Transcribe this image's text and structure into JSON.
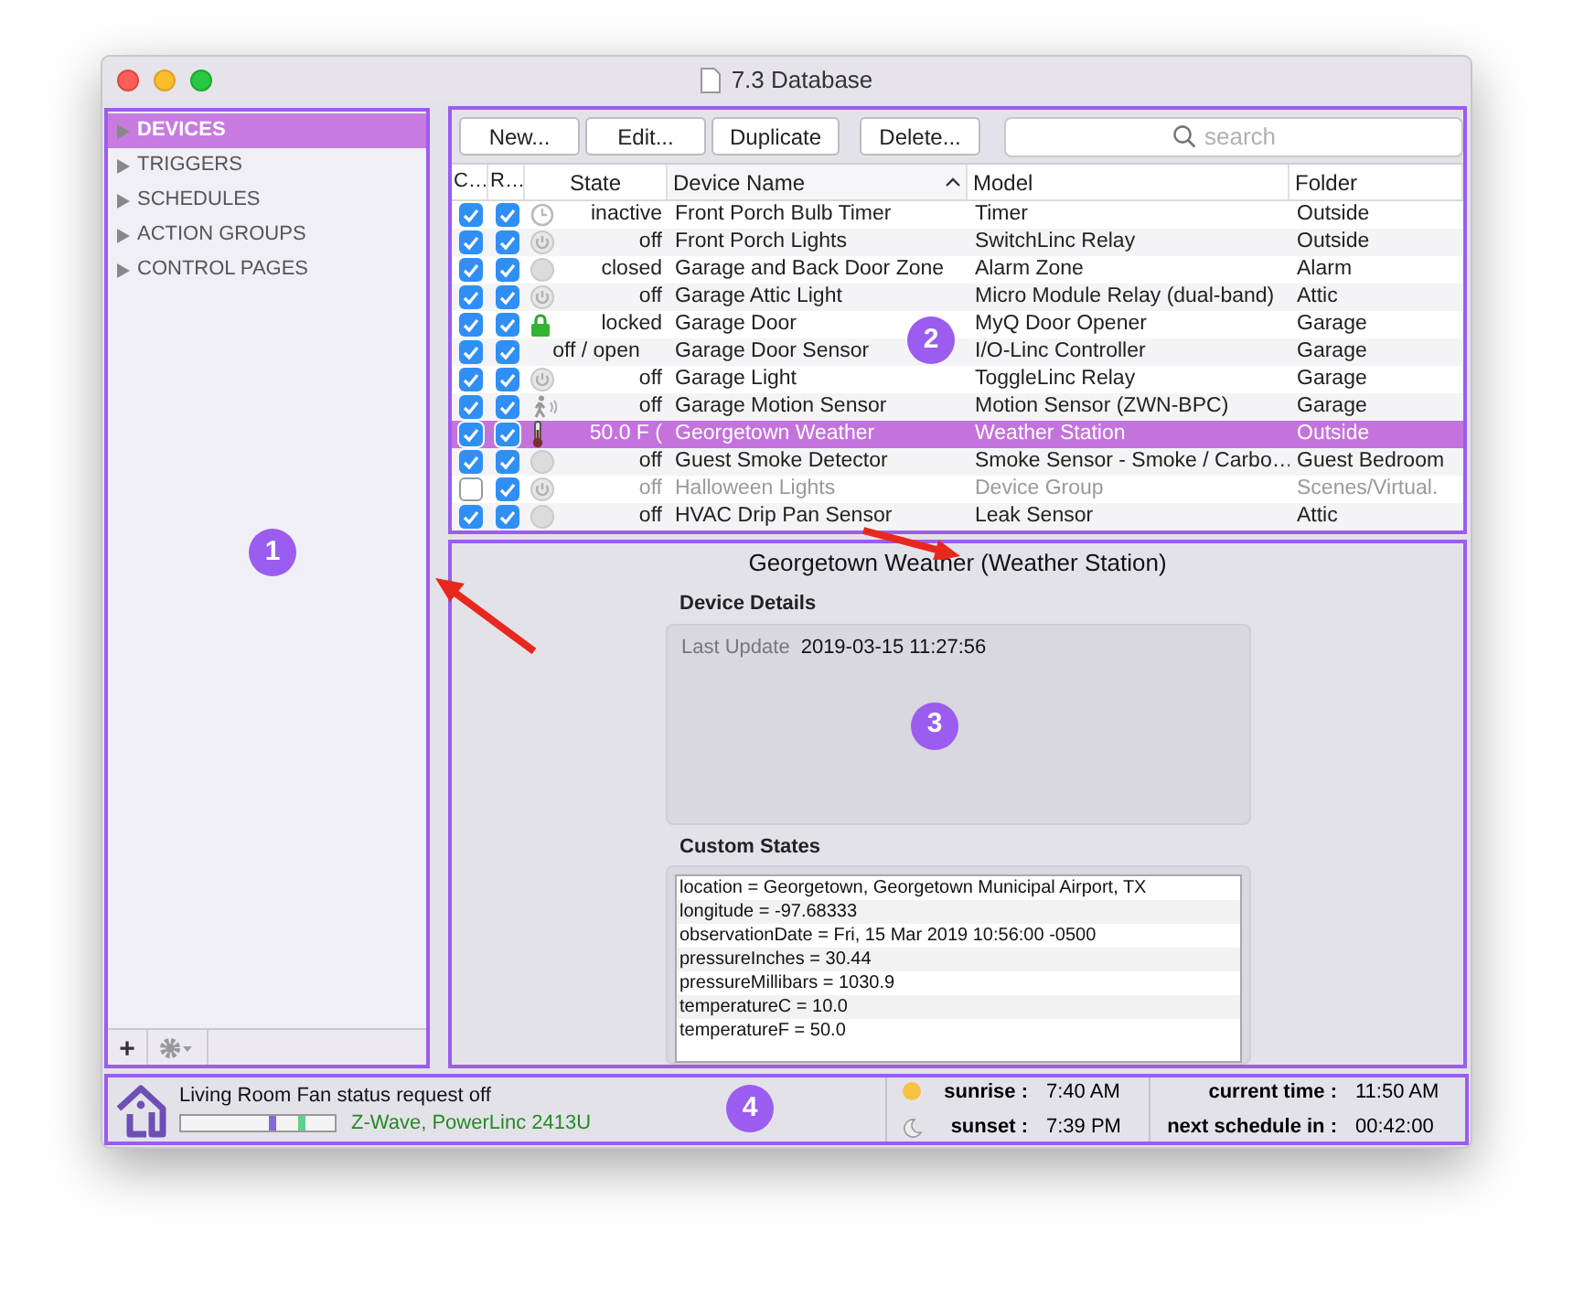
{
  "window": {
    "title": "7.3 Database"
  },
  "sidebar": {
    "items": [
      {
        "label": "DEVICES",
        "selected": true
      },
      {
        "label": "TRIGGERS",
        "selected": false
      },
      {
        "label": "SCHEDULES",
        "selected": false
      },
      {
        "label": "ACTION GROUPS",
        "selected": false
      },
      {
        "label": "CONTROL PAGES",
        "selected": false
      }
    ],
    "add_button": "+"
  },
  "toolbar": {
    "buttons": [
      "New...",
      "Edit...",
      "Duplicate",
      "Delete..."
    ],
    "search": {
      "placeholder": "search"
    }
  },
  "table": {
    "columns": [
      {
        "label": "C…",
        "sorted": false
      },
      {
        "label": "R…",
        "sorted": false
      },
      {
        "label": "State",
        "sorted": false
      },
      {
        "label": "Device Name",
        "sorted": true
      },
      {
        "label": "Model",
        "sorted": false
      },
      {
        "label": "Folder",
        "sorted": false
      }
    ],
    "rows": [
      {
        "c_checked": true,
        "r_checked": true,
        "kind": "timer",
        "state": "inactive",
        "name": "Front Porch Bulb Timer",
        "model": "Timer",
        "folder": "Outside",
        "selected": false
      },
      {
        "c_checked": true,
        "r_checked": true,
        "kind": "power",
        "state": "off",
        "name": "Front Porch Lights",
        "model": "SwitchLinc Relay",
        "folder": "Outside",
        "selected": false
      },
      {
        "c_checked": true,
        "r_checked": true,
        "kind": "sensor",
        "state": "closed",
        "name": "Garage and Back Door Zone",
        "model": "Alarm Zone",
        "folder": "Alarm",
        "selected": false
      },
      {
        "c_checked": true,
        "r_checked": true,
        "kind": "power",
        "state": "off",
        "name": "Garage Attic Light",
        "model": "Micro Module Relay (dual-band)",
        "folder": "Attic",
        "selected": false
      },
      {
        "c_checked": true,
        "r_checked": true,
        "kind": "lock",
        "state": "locked",
        "name": "Garage Door",
        "model": "MyQ Door Opener",
        "folder": "Garage",
        "selected": false
      },
      {
        "c_checked": true,
        "r_checked": true,
        "kind": "text",
        "state": "off / open",
        "name": "Garage Door Sensor",
        "model": "I/O-Linc Controller",
        "folder": "Garage",
        "selected": false
      },
      {
        "c_checked": true,
        "r_checked": true,
        "kind": "power",
        "state": "off",
        "name": "Garage Light",
        "model": "ToggleLinc Relay",
        "folder": "Garage",
        "selected": false
      },
      {
        "c_checked": true,
        "r_checked": true,
        "kind": "motion",
        "state": "off",
        "name": "Garage Motion Sensor",
        "model": "Motion Sensor (ZWN-BPC)",
        "folder": "Garage",
        "selected": false
      },
      {
        "c_checked": true,
        "r_checked": true,
        "kind": "thermometer",
        "state": "50.0 F (",
        "name": "Georgetown Weather",
        "model": "Weather Station",
        "folder": "Outside",
        "selected": true
      },
      {
        "c_checked": true,
        "r_checked": true,
        "kind": "sensor",
        "state": "off",
        "name": "Guest Smoke Detector",
        "model": "Smoke Sensor - Smoke / Carbo…",
        "folder": "Guest Bedroom",
        "selected": false
      },
      {
        "c_checked": false,
        "r_checked": true,
        "kind": "power",
        "state": "off",
        "name": "Halloween Lights",
        "model": "Device Group",
        "folder": "Scenes/Virtual.",
        "selected": false
      },
      {
        "c_checked": true,
        "r_checked": true,
        "kind": "sensor",
        "state": "off",
        "name": "HVAC Drip Pan Sensor",
        "model": "Leak Sensor",
        "folder": "Attic",
        "selected": false
      }
    ]
  },
  "details": {
    "title": "Georgetown Weather (Weather Station)",
    "device_details": {
      "heading": "Device Details",
      "label": "Last Update",
      "value": "2019-03-15 11:27:56"
    },
    "custom_states": {
      "heading": "Custom States",
      "lines": [
        "location = Georgetown, Georgetown Municipal Airport, TX",
        "longitude = -97.68333",
        "observationDate = Fri, 15 Mar 2019 10:56:00 -0500",
        "pressureInches = 30.44",
        "pressureMillibars = 1030.9",
        "temperatureC = 10.0",
        "temperatureF = 50.0"
      ]
    }
  },
  "status_bar": {
    "message": "Living Room Fan status request off",
    "interfaces": "Z-Wave, PowerLinc 2413U",
    "sunrise_label": "sunrise :",
    "sunrise": "7:40 AM",
    "sunset_label": "sunset :",
    "sunset": "7:39 PM",
    "current_time_label": "current time :",
    "current_time": "11:50 AM",
    "next_schedule_label": "next schedule in :",
    "next_schedule": "00:42:00"
  },
  "annotations": [
    "1",
    "2",
    "3",
    "4"
  ]
}
